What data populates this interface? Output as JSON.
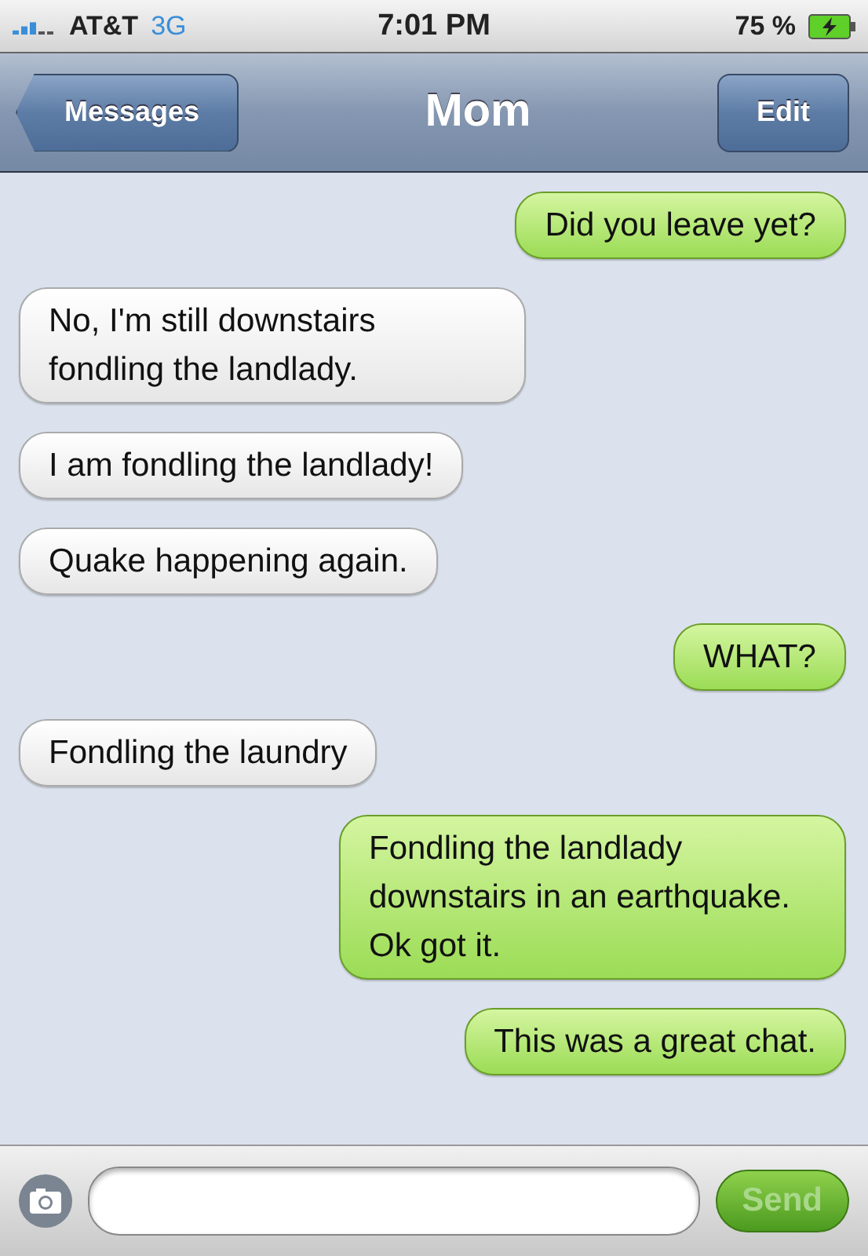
{
  "status_bar": {
    "carrier": "AT&T",
    "network": "3G",
    "time": "7:01 PM",
    "battery": "75 %"
  },
  "nav_bar": {
    "back": "Messages",
    "title": "Mom",
    "action": "Edit"
  },
  "messages": [
    {
      "text": "Did you leave yet?",
      "kind": "sent"
    },
    {
      "text": "No, I'm still downstairs fondling the landlady.",
      "kind": "received"
    },
    {
      "text": "I am fondling the landlady!",
      "kind": "received"
    },
    {
      "text": "Quake happening again.",
      "kind": "received"
    },
    {
      "text": "WHAT?",
      "kind": "sent"
    },
    {
      "text": "Fondling the laundry",
      "kind": "received"
    },
    {
      "text": "Fondling the landlady downstairs in an earthquake. Ok got it.",
      "kind": "sent"
    },
    {
      "text": "This was a great chat.",
      "kind": "sent"
    }
  ],
  "composer": {
    "send": "Send",
    "send_disabled": true
  }
}
